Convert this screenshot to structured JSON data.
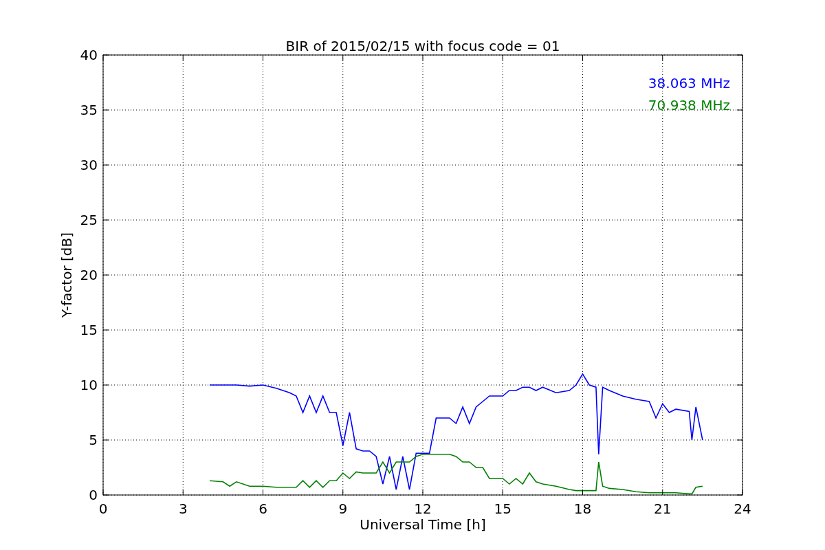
{
  "chart_data": {
    "type": "line",
    "title": "BIR of 2015/02/15 with focus code = 01",
    "xlabel": "Universal Time [h]",
    "ylabel": "Y-factor [dB]",
    "x": [
      4,
      4.5,
      4.75,
      5,
      5.5,
      6,
      6.5,
      7,
      7.25,
      7.5,
      7.75,
      8,
      8.25,
      8.5,
      8.75,
      9,
      9.25,
      9.5,
      9.75,
      10,
      10.25,
      10.5,
      10.75,
      11,
      11.25,
      11.5,
      11.75,
      12,
      12.25,
      12.5,
      12.75,
      13,
      13.25,
      13.5,
      13.75,
      14,
      14.25,
      14.5,
      14.75,
      15,
      15.25,
      15.5,
      15.75,
      16,
      16.25,
      16.5,
      17,
      17.5,
      17.75,
      18,
      18.25,
      18.5,
      18.6,
      18.75,
      19,
      19.5,
      20,
      20.5,
      20.75,
      21,
      21.25,
      21.5,
      22,
      22.1,
      22.25,
      22.5
    ],
    "series": [
      {
        "name": "38.063 MHz",
        "color": "#0000ff",
        "values": [
          10,
          10,
          10,
          10,
          9.9,
          10,
          9.7,
          9.3,
          9,
          7.5,
          9,
          7.5,
          9,
          7.5,
          7.5,
          4.5,
          7.5,
          4.2,
          4,
          4,
          3.5,
          1,
          3.5,
          0.5,
          3.5,
          0.5,
          3.8,
          3.8,
          3.8,
          7,
          7,
          7,
          6.5,
          8,
          6.5,
          8,
          8.5,
          9,
          9,
          9,
          9.5,
          9.5,
          9.8,
          9.8,
          9.5,
          9.8,
          9.3,
          9.5,
          10,
          11,
          10,
          9.8,
          3.7,
          9.8,
          9.5,
          9,
          8.7,
          8.5,
          7,
          8.3,
          7.5,
          7.8,
          7.6,
          5,
          8,
          5
        ]
      },
      {
        "name": "70.938 MHz",
        "color": "#008000",
        "values": [
          1.3,
          1.2,
          0.8,
          1.2,
          0.8,
          0.8,
          0.7,
          0.7,
          0.7,
          1.3,
          0.7,
          1.3,
          0.7,
          1.3,
          1.3,
          2,
          1.5,
          2.1,
          2,
          2,
          2,
          3,
          2,
          3,
          3,
          3,
          3.5,
          3.7,
          3.7,
          3.7,
          3.7,
          3.7,
          3.5,
          3,
          3,
          2.5,
          2.5,
          1.5,
          1.5,
          1.5,
          1,
          1.5,
          1,
          2,
          1.2,
          1,
          0.8,
          0.5,
          0.4,
          0.4,
          0.4,
          0.4,
          3,
          0.8,
          0.6,
          0.5,
          0.3,
          0.2,
          0.2,
          0.2,
          0.2,
          0.2,
          0.1,
          0.1,
          0.7,
          0.8
        ]
      }
    ],
    "grid": true,
    "xlim": [
      0,
      24
    ],
    "ylim": [
      0,
      40
    ],
    "xticks": [
      0,
      3,
      6,
      9,
      12,
      15,
      18,
      21,
      24
    ],
    "yticks": [
      0,
      5,
      10,
      15,
      20,
      25,
      30,
      35,
      40
    ]
  }
}
